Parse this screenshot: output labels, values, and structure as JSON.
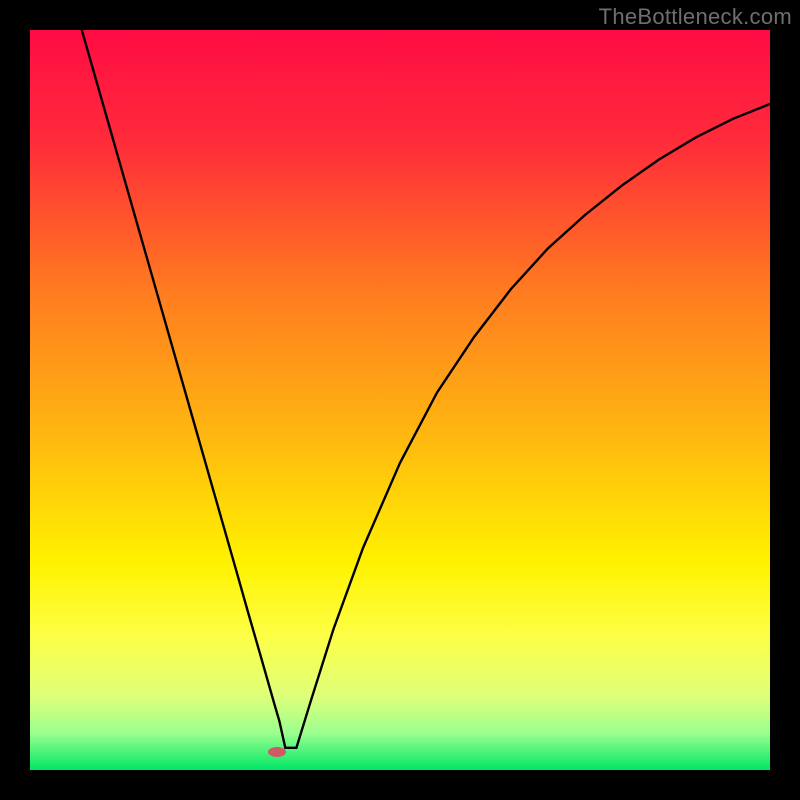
{
  "attribution": "TheBottleneck.com",
  "chart_data": {
    "type": "line",
    "title": "",
    "xlabel": "",
    "ylabel": "",
    "xlim": [
      0,
      100
    ],
    "ylim": [
      0,
      100
    ],
    "x": [
      7,
      10,
      13,
      16,
      19,
      22,
      25,
      28,
      29.5,
      31,
      32,
      33,
      33.7,
      34.5,
      36,
      38,
      41,
      45,
      50,
      55,
      60,
      65,
      70,
      75,
      80,
      85,
      90,
      95,
      100
    ],
    "values": [
      100,
      89.5,
      79,
      68.5,
      58,
      47.5,
      37,
      26.5,
      21.2,
      16,
      12.5,
      9,
      6.6,
      3,
      3,
      9.5,
      19,
      30,
      41.5,
      51,
      58.5,
      65,
      70.5,
      75,
      79,
      82.5,
      85.5,
      88,
      90
    ],
    "gradient_stops": [
      {
        "offset": 0,
        "color": "#ff0c44"
      },
      {
        "offset": 15,
        "color": "#ff2b3a"
      },
      {
        "offset": 35,
        "color": "#ff7a20"
      },
      {
        "offset": 55,
        "color": "#ffb810"
      },
      {
        "offset": 72,
        "color": "#fff200"
      },
      {
        "offset": 82,
        "color": "#fdff47"
      },
      {
        "offset": 90,
        "color": "#deff7a"
      },
      {
        "offset": 95,
        "color": "#9bff8f"
      },
      {
        "offset": 100,
        "color": "#00e765"
      }
    ],
    "marker": {
      "x": 33.4,
      "y": 2.5,
      "color": "#cf5a63"
    },
    "curve_color": "#000000",
    "curve_width": 2.4
  }
}
